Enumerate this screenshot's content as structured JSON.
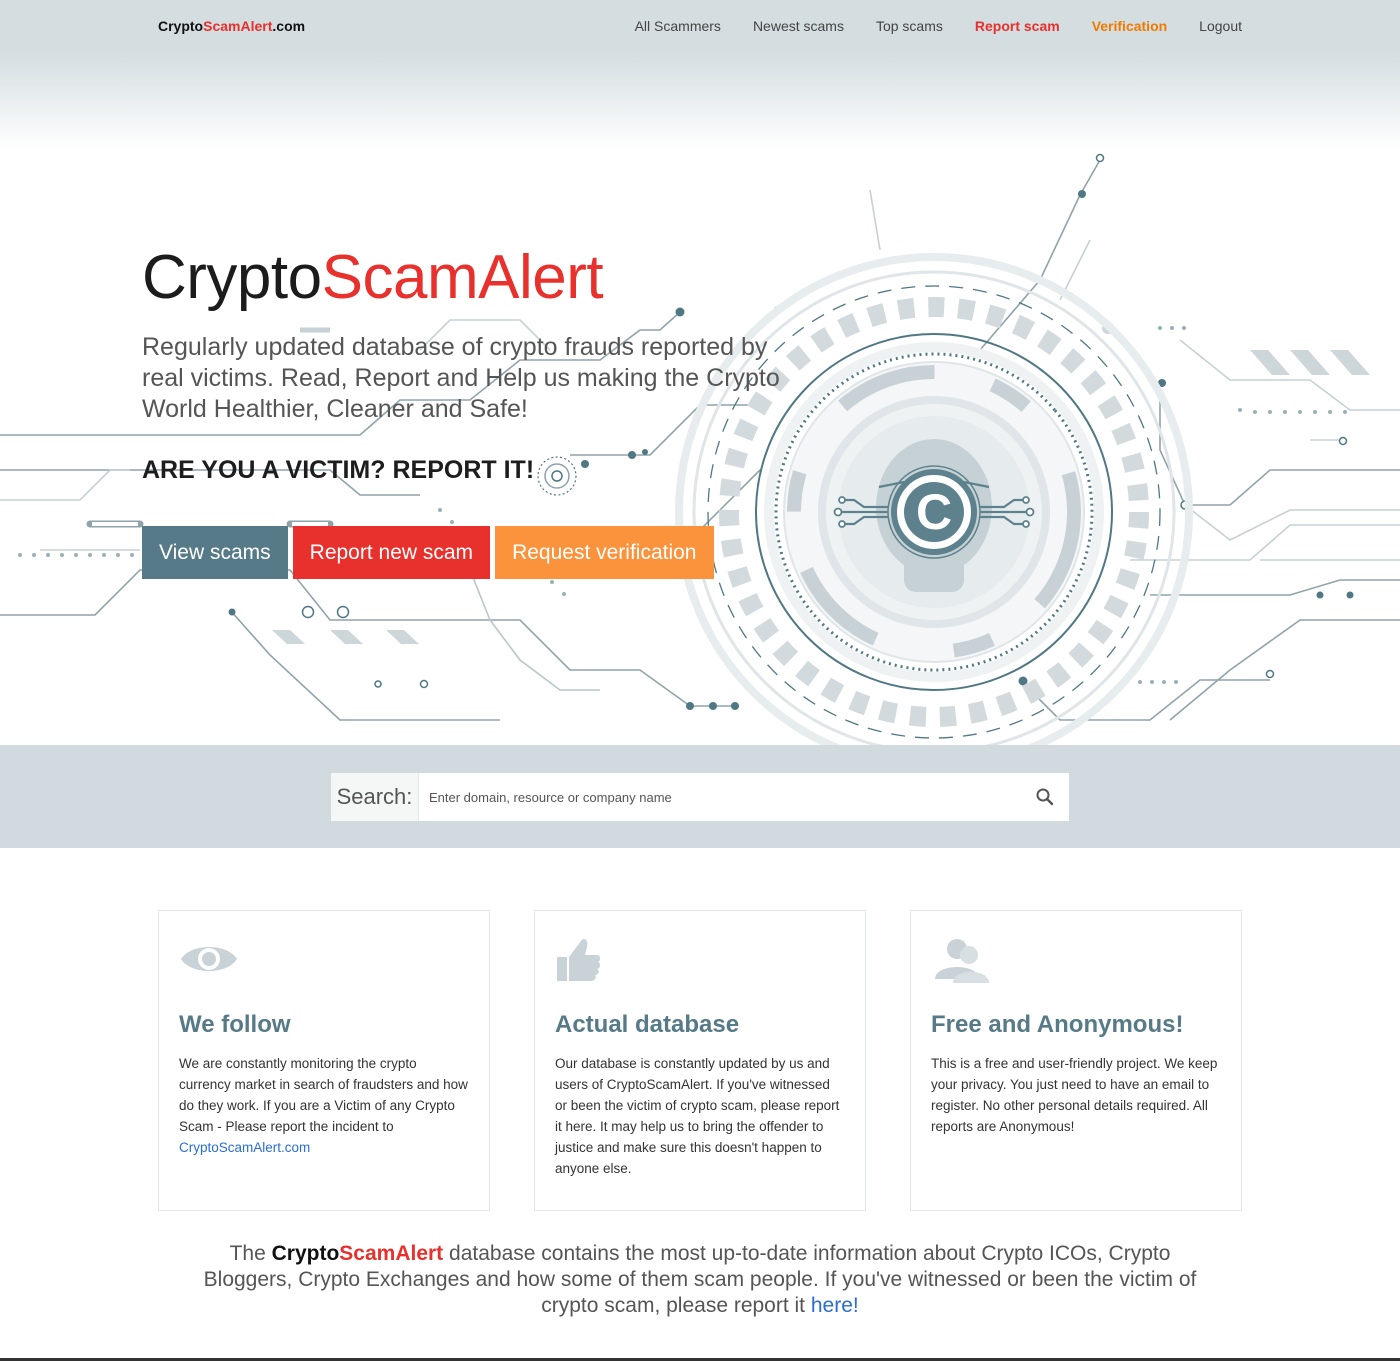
{
  "brand": {
    "part1": "Crypto",
    "part2": "ScamAlert",
    "part3": ".com"
  },
  "nav": {
    "all_scammers": "All Scammers",
    "newest_scams": "Newest scams",
    "top_scams": "Top scams",
    "report_scam": "Report scam",
    "verification": "Verification",
    "logout": "Logout"
  },
  "hero": {
    "title_part1": "Crypto",
    "title_part2": "ScamAlert",
    "subtitle": "Regularly updated database of crypto frauds reported by real victims. Read, Report and Help us making the Crypto World Healthier, Cleaner and Safe!",
    "cta": "ARE YOU A VICTIM? REPORT IT!",
    "buttons": {
      "view": "View scams",
      "report": "Report new scam",
      "verify": "Request verification"
    },
    "emblem_letter": "C"
  },
  "search": {
    "label": "Search:",
    "placeholder": "Enter domain, resource or company name"
  },
  "features": [
    {
      "icon": "eye-icon",
      "title": "We follow",
      "text": "We are constantly monitoring the crypto currency market in search of fraudsters and how do they work. If you are a Victim of any Crypto Scam - Please report the incident to ",
      "link": "CryptoScamAlert.com"
    },
    {
      "icon": "thumbs-up-icon",
      "title": "Actual database",
      "text": "Our database is constantly updated by us and users of CryptoScamAlert. If you've witnessed or been the victim of crypto scam, please report it here. It may help us to bring the offender to justice and make sure this doesn't happen to anyone else."
    },
    {
      "icon": "users-icon",
      "title": "Free and Anonymous!",
      "text": "This is a free and user-friendly project. We keep your privacy. You just need to have an email to register. No other personal details required. All reports are Anonymous!"
    }
  ],
  "bottom": {
    "prefix": "The ",
    "brand_part1": "Crypto",
    "brand_part2": "ScamAlert",
    "text": " database contains the most up-to-date information about Crypto ICOs, Crypto Bloggers, Crypto Exchanges and how some of them scam people. If you've witnessed or been the victim of crypto scam, please report it ",
    "link": "here!"
  },
  "colors": {
    "accent_red": "#e8302c",
    "accent_orange": "#fb923c",
    "accent_slate": "#567a87",
    "link_blue": "#2a6fd0",
    "band_gray": "#d1dbdf"
  }
}
